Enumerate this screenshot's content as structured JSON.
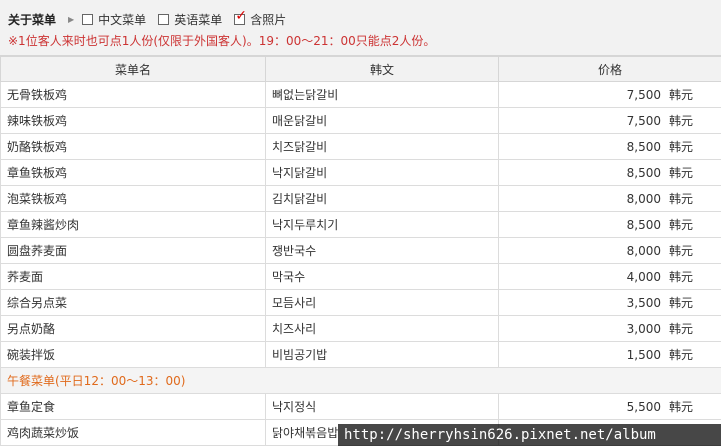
{
  "options": {
    "title": "关于菜单",
    "items": [
      {
        "label": "中文菜单",
        "checked": false
      },
      {
        "label": "英语菜单",
        "checked": false
      },
      {
        "label": "含照片",
        "checked": true
      }
    ]
  },
  "note": "※1位客人来时也可点1人份(仅限于外国客人)。19：00～21：00只能点2人份。",
  "table": {
    "headers": [
      "菜单名",
      "韩文",
      "价格"
    ],
    "currency": "韩元",
    "rows": [
      {
        "name": "无骨铁板鸡",
        "korean": "뼈없는닭갈비",
        "price": "7,500"
      },
      {
        "name": "辣味铁板鸡",
        "korean": "매운닭갈비",
        "price": "7,500"
      },
      {
        "name": "奶酪铁板鸡",
        "korean": "치즈닭갈비",
        "price": "8,500"
      },
      {
        "name": "章鱼铁板鸡",
        "korean": "낙지닭갈비",
        "price": "8,500"
      },
      {
        "name": "泡菜铁板鸡",
        "korean": "김치닭갈비",
        "price": "8,000"
      },
      {
        "name": "章鱼辣酱炒肉",
        "korean": "낙지두루치기",
        "price": "8,500"
      },
      {
        "name": "圆盘荞麦面",
        "korean": "쟁반국수",
        "price": "8,000"
      },
      {
        "name": "荞麦面",
        "korean": "막국수",
        "price": "4,000"
      },
      {
        "name": "综合另点菜",
        "korean": "모듬사리",
        "price": "3,500"
      },
      {
        "name": "另点奶酪",
        "korean": "치즈사리",
        "price": "3,000"
      },
      {
        "name": "碗装拌饭",
        "korean": "비빔공기밥",
        "price": "1,500"
      }
    ],
    "section": "午餐菜单(平日12：00～13：00)",
    "lunch_rows": [
      {
        "name": "章鱼定食",
        "korean": "낙지정식",
        "price": "5,500"
      },
      {
        "name": "鸡肉蔬菜炒饭",
        "korean": "닭야채볶음밥",
        "price": ""
      }
    ]
  },
  "watermark": "http://sherryhsin626.pixnet.net/album"
}
